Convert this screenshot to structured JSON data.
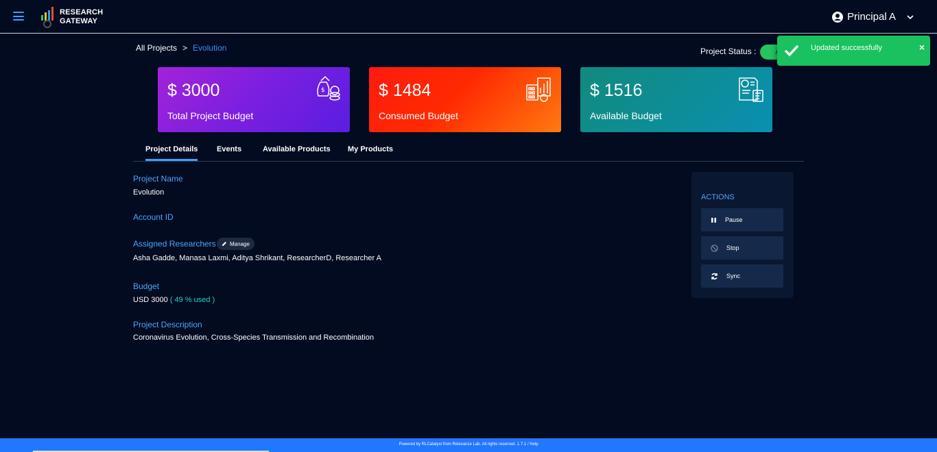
{
  "header": {
    "app_name_line1": "RESEARCH",
    "app_name_line2": "GATEWAY",
    "user_name": "Principal A"
  },
  "breadcrumb": {
    "root": "All Projects",
    "separator": ">",
    "current": "Evolution"
  },
  "project_status": {
    "label": "Project Status :",
    "value": "Ac"
  },
  "toast": {
    "message": "Updated successfully",
    "close": "×"
  },
  "cards": [
    {
      "amount": "$ 3000",
      "label": "Total Project Budget",
      "icon": "money-bag-coins-icon"
    },
    {
      "amount": "$ 1484",
      "label": "Consumed Budget",
      "icon": "calculator-chart-icon"
    },
    {
      "amount": "$ 1516",
      "label": "Available Budget",
      "icon": "invoice-calculator-icon"
    }
  ],
  "tabs": [
    {
      "label": "Project Details",
      "active": true
    },
    {
      "label": "Events"
    },
    {
      "label": "Available Products"
    },
    {
      "label": "My Products"
    }
  ],
  "details": {
    "project_name_label": "Project Name",
    "project_name": "Evolution",
    "account_id_label": "Account ID",
    "account_id": "",
    "researchers_label": "Assigned Researchers",
    "manage_label": "Manage",
    "researchers": "Asha Gadde, Manasa Laxmi, Aditya Shrikant, ResearcherD, Researcher A",
    "budget_label": "Budget",
    "budget_value": "USD 3000",
    "budget_used": "( 49 % used )",
    "description_label": "Project Description",
    "description": "Coronavirus Evolution, Cross-Species Transmission and Recombination"
  },
  "actions": {
    "title": "ACTIONS",
    "pause": "Pause",
    "stop": "Stop",
    "sync": "Sync"
  },
  "footer": {
    "text": "Powered by RLCatalyst from Relevance Lab. All rights reserved. 1.7.1 / Help"
  },
  "colors": {
    "background": "#020b1f",
    "accent": "#3aa0ff",
    "toast": "#19c15f",
    "footer": "#2277ff"
  }
}
